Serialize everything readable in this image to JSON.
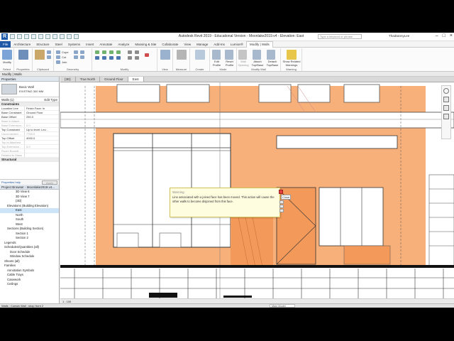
{
  "app": {
    "title": "Autodesk Revit 2019 - Educational Version - Moonlake2019.v4 - Elevation: East",
    "logo": "R",
    "search_placeholder": "Type a keyword or phrase",
    "user": "ThaiDannyLee"
  },
  "tabs": [
    "File",
    "Architecture",
    "Structure",
    "Steel",
    "Systems",
    "Insert",
    "Annotate",
    "Analyze",
    "Massing & Site",
    "Collaborate",
    "View",
    "Manage",
    "Add-Ins",
    "Lumion®",
    "Modify | Walls"
  ],
  "ribbon": {
    "modify": "Modify",
    "select": "Select",
    "properties": "Properties",
    "clipboard": "Clipboard",
    "geometry": "Geometry",
    "cope": "Cope",
    "cut": "Cut",
    "join": "Join",
    "modify_group": "Modify",
    "view": "View",
    "measure": "Measure",
    "create": "Create",
    "mode": "Mode",
    "modify_wall": "Modify Wall",
    "warning": "Warning",
    "edit_profile": "Edit Profile",
    "reset_profile": "Reset Profile",
    "wall_opening": "Wall Opening",
    "attach": "Attach Top/Base",
    "detach": "Detach Top/Base",
    "show_warnings": "Show Related Warnings"
  },
  "context_bar": "Modify | Walls",
  "properties": {
    "header": "Properties",
    "type_name": "Basic Wall",
    "type_sub": "EXISTING 300 MM",
    "instance": "Walls (1)",
    "edit_type": "Edit Type",
    "constraints": "Constraints",
    "rows": [
      {
        "k": "Location Line",
        "v": "Finish Face: In"
      },
      {
        "k": "Base Constraint",
        "v": "Ground Floor"
      },
      {
        "k": "Base Offset",
        "v": "250.0"
      },
      {
        "k": "Base is Attach...",
        "v": ""
      },
      {
        "k": "Base Extension...",
        "v": "0.0"
      },
      {
        "k": "Top Constraint",
        "v": "Up to level: Lev..."
      },
      {
        "k": "Unconnected ...",
        "v": "7700.0"
      },
      {
        "k": "Top Offset",
        "v": "4000.0"
      },
      {
        "k": "Top is Attached",
        "v": ""
      },
      {
        "k": "Top Extension...",
        "v": "0.0"
      },
      {
        "k": "Room Boundi...",
        "v": ""
      },
      {
        "k": "Related to Mass",
        "v": ""
      }
    ],
    "structural": "Structural",
    "help": "Properties help",
    "apply": "Apply"
  },
  "browser": {
    "header": "Project Browser - Moonlake2019.v4...",
    "items": [
      {
        "t": "3D View 6",
        "i": 5,
        "sel": false
      },
      {
        "t": "3D View 7",
        "i": 5,
        "sel": false
      },
      {
        "t": "{3D}",
        "i": 5,
        "sel": false
      },
      {
        "t": "Elevations (Building Elevation)",
        "i": 2,
        "sel": false
      },
      {
        "t": "East",
        "i": 5,
        "sel": true
      },
      {
        "t": "North",
        "i": 5,
        "sel": false
      },
      {
        "t": "South",
        "i": 5,
        "sel": false
      },
      {
        "t": "West",
        "i": 5,
        "sel": false
      },
      {
        "t": "Sections (Building Section)",
        "i": 2,
        "sel": false
      },
      {
        "t": "Section 1",
        "i": 5,
        "sel": false
      },
      {
        "t": "Section 2",
        "i": 5,
        "sel": false
      },
      {
        "t": "Legends",
        "i": 1,
        "sel": false
      },
      {
        "t": "Schedules/Quantities (all)",
        "i": 1,
        "sel": false
      },
      {
        "t": "Door Schedule",
        "i": 3,
        "sel": false
      },
      {
        "t": "Window Schedule",
        "i": 3,
        "sel": false
      },
      {
        "t": "Sheets (all)",
        "i": 1,
        "sel": false
      },
      {
        "t": "Families",
        "i": 1,
        "sel": false
      },
      {
        "t": "Annotation Symbols",
        "i": 2,
        "sel": false
      },
      {
        "t": "Cable Trays",
        "i": 2,
        "sel": false
      },
      {
        "t": "Casework",
        "i": 2,
        "sel": false
      },
      {
        "t": "Ceilings",
        "i": 2,
        "sel": false
      }
    ]
  },
  "view_tabs": [
    "{3D}",
    "True North",
    "Ground Floor",
    "East"
  ],
  "view_bar": "1 : 100",
  "status": "Walls : Curtain Wall : shop front 2",
  "status_model": "Main Model",
  "warning": {
    "title": "Warning",
    "message": "Line associated with a joined face has been moved. This action will cause the other walls to become disjoined from this face.",
    "close_tip": "Close"
  },
  "colors": {
    "orange": "#f7b07a",
    "orange_dark": "#f39a5b",
    "revit_blue": "#1e5aa8",
    "warning_bg": "#fffde0"
  }
}
